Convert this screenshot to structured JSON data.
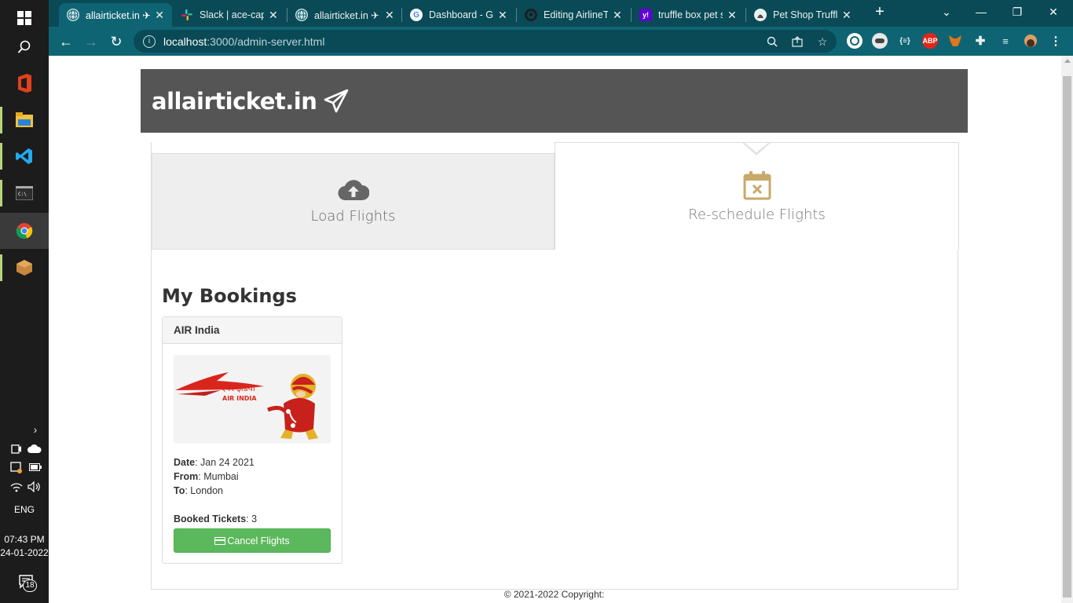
{
  "taskbar": {
    "time": "07:43 PM",
    "date": "24-01-2022",
    "language": "ENG",
    "notification_count": "18"
  },
  "browser": {
    "tabs": [
      {
        "title": "allairticket.in ✈",
        "favicon": "globe-icon",
        "active": true
      },
      {
        "title": "Slack | ace-caps",
        "favicon": "slack-icon",
        "active": false
      },
      {
        "title": "allairticket.in ✈",
        "favicon": "globe-icon",
        "active": false
      },
      {
        "title": "Dashboard - Gr",
        "favicon": "google-icon",
        "active": false
      },
      {
        "title": "Editing AirlineT",
        "favicon": "github-icon",
        "active": false
      },
      {
        "title": "truffle box pet s",
        "favicon": "yahoo-icon",
        "active": false
      },
      {
        "title": "Pet Shop Truffle",
        "favicon": "truffle-icon",
        "active": false
      }
    ],
    "url_host": "localhost",
    "url_rest": ":3000/admin-server.html",
    "extensions": [
      "ABP"
    ]
  },
  "site": {
    "brand": "allairticket.in",
    "tabs": {
      "load": "Load Flights",
      "reschedule": "Re-schedule Flights"
    },
    "bookings_title": "My Bookings",
    "booking": {
      "airline": "AIR India",
      "date_label": "Date",
      "date": "Jan 24 2021",
      "from_label": "From",
      "from": "Mumbai",
      "to_label": "To",
      "to": "London",
      "tickets_label": "Booked Tickets",
      "tickets": "3",
      "cancel_label": "Cancel Flights",
      "logo_text": "एयर इंडिया",
      "logo_text_en": "AIR INDIA"
    },
    "footer": "© 2021-2022 Copyright:"
  },
  "colors": {
    "tab_strip": "#0a4a56",
    "toolbar": "#0f6473",
    "site_header": "#555555",
    "button_green": "#5cb85c",
    "accent_gold": "#c8a96a"
  }
}
